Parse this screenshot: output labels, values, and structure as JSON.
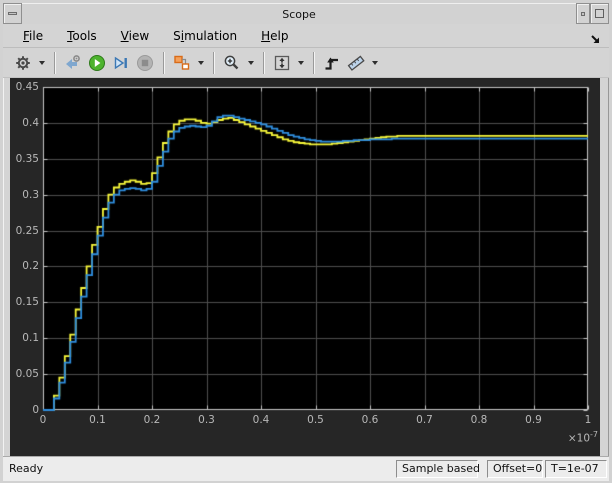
{
  "window": {
    "title": "Scope"
  },
  "titlebar": {
    "icons": [
      "window-menu",
      "minimize",
      "maximize"
    ]
  },
  "menubar": {
    "items": [
      {
        "pre": "",
        "key": "F",
        "post": "ile"
      },
      {
        "pre": "",
        "key": "T",
        "post": "ools"
      },
      {
        "pre": "",
        "key": "V",
        "post": "iew"
      },
      {
        "pre": "S",
        "key": "i",
        "post": "mulation"
      },
      {
        "pre": "",
        "key": "H",
        "post": "elp"
      }
    ]
  },
  "toolbar": {
    "icons": [
      "settings-gear",
      "step-back",
      "run",
      "step-forward",
      "stop",
      "highlight-simulink-block",
      "zoom-in",
      "fit-to-view",
      "trigger",
      "cursor-measurements"
    ]
  },
  "statusbar": {
    "left": "Ready",
    "panels": [
      "Sample based",
      "Offset=0",
      "T=1e-07"
    ]
  },
  "colors": {
    "chrome_bg": "#d4d4d4",
    "canvas_bg": "#262626",
    "plot_bg": "#000000",
    "grid": "#4f4f4f",
    "frame": "#c8c8c8",
    "tick_text": "#b8b8b8",
    "trace_yellow": "#f8f83a",
    "trace_blue": "#2f8fe0"
  },
  "chart_data": {
    "type": "line",
    "style": "staircase-step-response",
    "title": "",
    "xlabel": "",
    "ylabel": "",
    "xlim": [
      0,
      1
    ],
    "ylim": [
      0,
      0.45
    ],
    "grid": true,
    "x_exponent_base": "×10",
    "x_exponent_sup": "-7",
    "x_start": 0,
    "x_step": 0.01,
    "x_ticks": [
      {
        "v": 0,
        "label": "0"
      },
      {
        "v": 0.1,
        "label": "0.1"
      },
      {
        "v": 0.2,
        "label": "0.2"
      },
      {
        "v": 0.3,
        "label": "0.3"
      },
      {
        "v": 0.4,
        "label": "0.4"
      },
      {
        "v": 0.5,
        "label": "0.5"
      },
      {
        "v": 0.6,
        "label": "0.6"
      },
      {
        "v": 0.7,
        "label": "0.7"
      },
      {
        "v": 0.8,
        "label": "0.8"
      },
      {
        "v": 0.9,
        "label": "0.9"
      },
      {
        "v": 1,
        "label": "1"
      }
    ],
    "y_ticks": [
      {
        "v": 0,
        "label": "0"
      },
      {
        "v": 0.05,
        "label": "0.05"
      },
      {
        "v": 0.1,
        "label": "0.1"
      },
      {
        "v": 0.15,
        "label": "0.15"
      },
      {
        "v": 0.2,
        "label": "0.2"
      },
      {
        "v": 0.25,
        "label": "0.25"
      },
      {
        "v": 0.3,
        "label": "0.3"
      },
      {
        "v": 0.35,
        "label": "0.35"
      },
      {
        "v": 0.4,
        "label": "0.4"
      },
      {
        "v": 0.45,
        "label": "0.45"
      }
    ],
    "series": [
      {
        "name": "signal-1-yellow",
        "color": "#f8f83a",
        "values": [
          0.0,
          0.0,
          0.02,
          0.045,
          0.075,
          0.105,
          0.14,
          0.17,
          0.2,
          0.23,
          0.255,
          0.28,
          0.3,
          0.31,
          0.315,
          0.318,
          0.32,
          0.318,
          0.315,
          0.316,
          0.33,
          0.352,
          0.372,
          0.388,
          0.398,
          0.403,
          0.405,
          0.405,
          0.403,
          0.4,
          0.399,
          0.401,
          0.404,
          0.406,
          0.407,
          0.404,
          0.401,
          0.398,
          0.395,
          0.392,
          0.389,
          0.386,
          0.383,
          0.38,
          0.377,
          0.375,
          0.373,
          0.372,
          0.371,
          0.37,
          0.37,
          0.37,
          0.37,
          0.371,
          0.372,
          0.373,
          0.374,
          0.375,
          0.376,
          0.377,
          0.378,
          0.379,
          0.38,
          0.381,
          0.381,
          0.382,
          0.382,
          0.382,
          0.382,
          0.382,
          0.382,
          0.382,
          0.382,
          0.382,
          0.382,
          0.382,
          0.382,
          0.382,
          0.382,
          0.382,
          0.382,
          0.382,
          0.382,
          0.382,
          0.382,
          0.382,
          0.382,
          0.382,
          0.382,
          0.382,
          0.382,
          0.382,
          0.382,
          0.382,
          0.382,
          0.382,
          0.382,
          0.382,
          0.382,
          0.382,
          0.382
        ]
      },
      {
        "name": "signal-2-blue",
        "color": "#2f8fe0",
        "values": [
          0.0,
          0.0,
          0.016,
          0.038,
          0.066,
          0.095,
          0.128,
          0.158,
          0.188,
          0.217,
          0.243,
          0.268,
          0.289,
          0.3,
          0.306,
          0.308,
          0.309,
          0.308,
          0.306,
          0.308,
          0.318,
          0.34,
          0.36,
          0.378,
          0.388,
          0.393,
          0.395,
          0.396,
          0.395,
          0.394,
          0.396,
          0.402,
          0.408,
          0.41,
          0.41,
          0.408,
          0.406,
          0.404,
          0.402,
          0.4,
          0.398,
          0.395,
          0.392,
          0.389,
          0.386,
          0.383,
          0.381,
          0.379,
          0.377,
          0.376,
          0.375,
          0.374,
          0.374,
          0.374,
          0.374,
          0.375,
          0.375,
          0.376,
          0.376,
          0.376,
          0.377,
          0.377,
          0.377,
          0.377,
          0.378,
          0.378,
          0.378,
          0.378,
          0.378,
          0.378,
          0.378,
          0.378,
          0.378,
          0.378,
          0.378,
          0.378,
          0.378,
          0.378,
          0.378,
          0.378,
          0.378,
          0.378,
          0.378,
          0.378,
          0.378,
          0.378,
          0.378,
          0.378,
          0.378,
          0.378,
          0.378,
          0.378,
          0.378,
          0.378,
          0.378,
          0.378,
          0.378,
          0.378,
          0.378,
          0.378,
          0.378
        ]
      }
    ]
  }
}
